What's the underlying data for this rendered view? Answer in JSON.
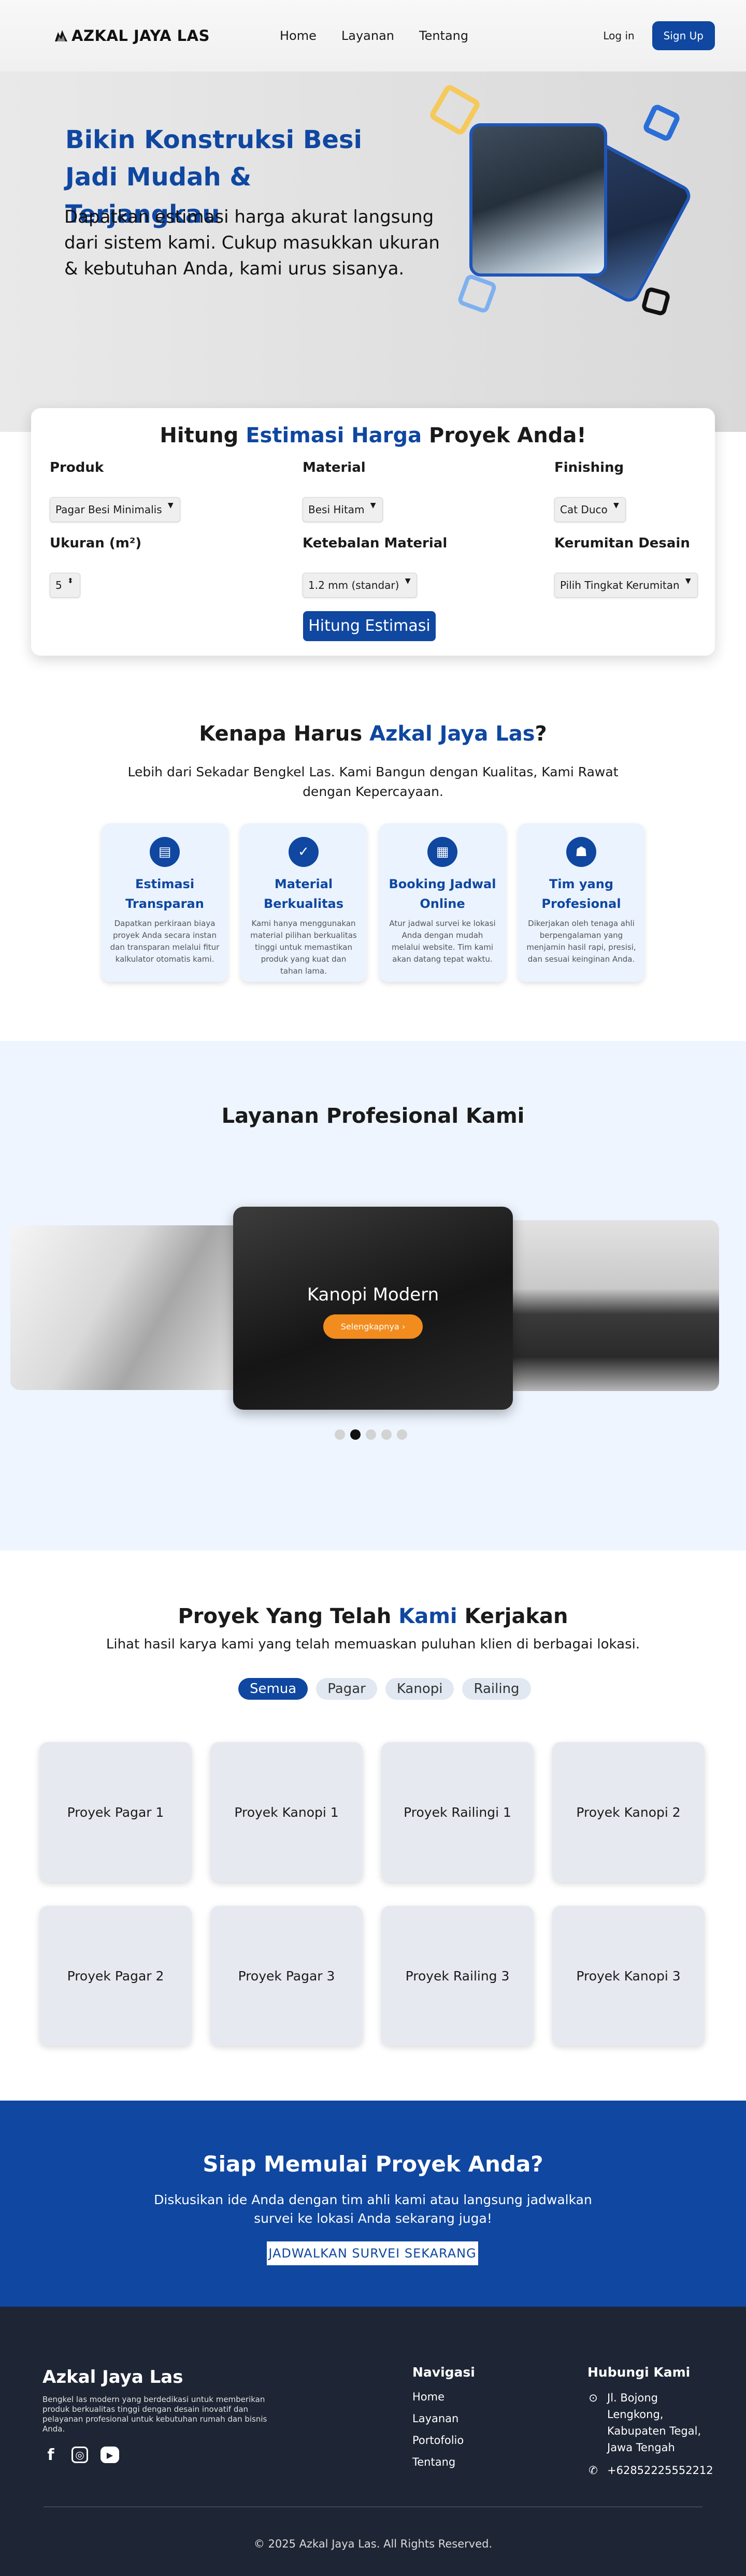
{
  "nav": {
    "brand": "AZKAL JAYA LAS",
    "links": [
      "Home",
      "Layanan",
      "Tentang"
    ],
    "login": "Log in",
    "signup": "Sign Up"
  },
  "hero": {
    "title": "Bikin Konstruksi Besi Jadi Mudah & Terjangkau",
    "subtitle": "Dapatkan estimasi harga akurat langsung dari sistem kami. Cukup masukkan ukuran & kebutuhan Anda, kami urus sisanya."
  },
  "estimate": {
    "title_pre": "Hitung ",
    "title_hl": "Estimasi Harga",
    "title_post": " Proyek Anda!",
    "fields": [
      {
        "label": "Produk",
        "value": "Pagar Besi Minimalis"
      },
      {
        "label": "Material",
        "value": "Besi Hitam"
      },
      {
        "label": "Finishing",
        "value": "Cat Duco"
      },
      {
        "label": "Ukuran (m²)",
        "value": "5"
      },
      {
        "label": "Ketebalan Material",
        "value": "1.2 mm (standar)"
      },
      {
        "label": "Kerumitan Desain",
        "value": "Pilih Tingkat Kerumitan"
      }
    ],
    "button": "Hitung Estimasi"
  },
  "why": {
    "title_pre": "Kenapa Harus ",
    "title_hl": "Azkal Jaya Las",
    "title_post": "?",
    "subtitle": "Lebih dari Sekadar Bengkel Las. Kami Bangun dengan Kualitas, Kami Rawat dengan Kepercayaan.",
    "features": [
      {
        "icon": "document-icon",
        "title": "Estimasi Transparan",
        "desc": "Dapatkan perkiraan biaya proyek Anda secara instan dan transparan melalui fitur kalkulator otomatis kami."
      },
      {
        "icon": "shield-check-icon",
        "title": "Material Berkualitas",
        "desc": "Kami hanya menggunakan material pilihan berkualitas tinggi untuk memastikan produk yang kuat dan tahan lama."
      },
      {
        "icon": "calendar-check-icon",
        "title": "Booking Jadwal Online",
        "desc": "Atur jadwal survei ke lokasi Anda dengan mudah melalui website. Tim kami akan datang tepat waktu."
      },
      {
        "icon": "team-icon",
        "title": "Tim yang Profesional",
        "desc": "Dikerjakan oleh tenaga ahli berpengalaman yang menjamin hasil rapi, presisi, dan sesuai keinginan Anda."
      }
    ]
  },
  "services": {
    "title": "Layanan Profesional Kami",
    "active_slide": "Kanopi Modern",
    "detail_button": "Selengkapnya",
    "active_dot": 2,
    "dot_count": 5
  },
  "projects": {
    "title_pre": "Proyek Yang Telah ",
    "title_hl": "Kami",
    "title_post": " Kerjakan",
    "subtitle": "Lihat hasil karya kami yang telah memuaskan puluhan klien di berbagai lokasi.",
    "filters": [
      "Semua",
      "Pagar",
      "Kanopi",
      "Railing"
    ],
    "active_filter": "Semua",
    "items": [
      "Proyek Pagar 1",
      "Proyek Kanopi 1",
      "Proyek Railingi 1",
      "Proyek Kanopi 2",
      "Proyek Pagar 2",
      "Proyek Pagar 3",
      "Proyek Railing 3",
      "Proyek Kanopi 3"
    ]
  },
  "cta": {
    "title": "Siap Memulai Proyek Anda?",
    "subtitle": "Diskusikan ide Anda dengan tim ahli kami atau langsung jadwalkan survei ke lokasi Anda sekarang juga!",
    "button": "JADWALKAN SURVEI SEKARANG"
  },
  "footer": {
    "brand": "Azkal Jaya Las",
    "desc": "Bengkel las modern yang berdedikasi untuk memberikan produk berkualitas tinggi dengan desain inovatif dan pelayanan profesional untuk kebutuhan rumah dan bisnis Anda.",
    "nav_head": "Navigasi",
    "nav_links": [
      "Home",
      "Layanan",
      "Portofolio",
      "Tentang"
    ],
    "contact_head": "Hubungi Kami",
    "address": "Jl. Bojong Lengkong, Kabupaten Tegal, Jawa Tengah",
    "phone": "+62852225552212",
    "copyright": "© 2025 Azkal Jaya Las. All Rights Reserved."
  },
  "colors": {
    "primary": "#0f47a1",
    "accent": "#f28c1e",
    "footer_bg": "#1e2534",
    "card_bg": "#eaf3fe"
  }
}
